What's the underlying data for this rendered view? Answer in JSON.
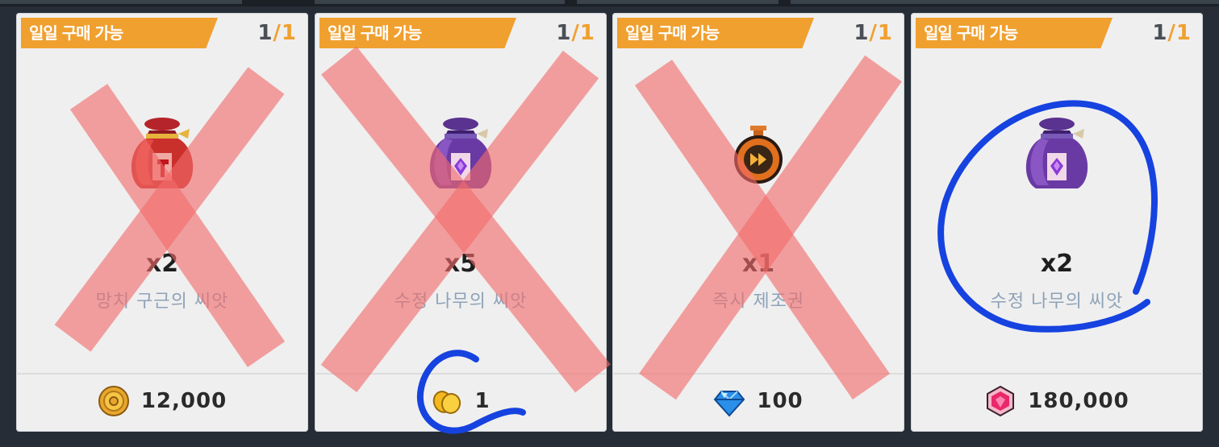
{
  "shop": {
    "cards": [
      {
        "tag": "일일 구매 가능",
        "limit_current": "1",
        "limit_max": "1",
        "quantity": "x2",
        "item_name": "망치 구근의 씨앗",
        "item_icon": "red-seed-bag-icon",
        "currency_icon": "gold-coin-icon",
        "price": "12,000",
        "crossed_out": true
      },
      {
        "tag": "일일 구매 가능",
        "limit_current": "1",
        "limit_max": "1",
        "quantity": "x5",
        "item_name": "수정 나무의 씨앗",
        "item_icon": "purple-seed-bag-icon",
        "currency_icon": "golden-leaf-icon",
        "price": "1",
        "crossed_out": true
      },
      {
        "tag": "일일 구매 가능",
        "limit_current": "1",
        "limit_max": "1",
        "quantity": "x1",
        "item_name": "즉시 제조권",
        "item_icon": "fast-forward-stopwatch-icon",
        "currency_icon": "blue-diamond-icon",
        "price": "100",
        "crossed_out": true
      },
      {
        "tag": "일일 구매 가능",
        "limit_current": "1",
        "limit_max": "1",
        "quantity": "x2",
        "item_name": "수정 나무의 씨앗",
        "item_icon": "purple-seed-bag-icon",
        "currency_icon": "pink-gem-icon",
        "price": "180,000",
        "crossed_out": false
      }
    ]
  },
  "annotations": {
    "cross_color": "#f26b6b",
    "pen_color": "#1642e0",
    "circled_card": 4,
    "circled_price_card": 2
  }
}
